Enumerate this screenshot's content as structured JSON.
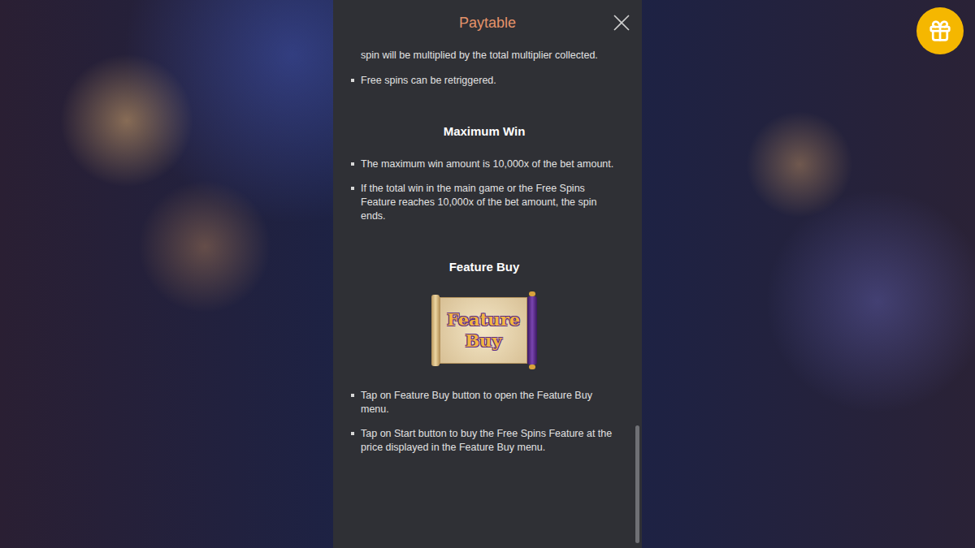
{
  "header": {
    "title": "Paytable"
  },
  "intro": [
    {
      "kind": "continuation",
      "text": "spin will be multiplied by the total multiplier collected."
    },
    {
      "kind": "bullet",
      "text": "Free spins can be retriggered."
    }
  ],
  "sections": [
    {
      "title": "Maximum Win",
      "badge": null,
      "items": [
        "The maximum win amount is 10,000x of the bet amount.",
        "If the total win in the main game or the Free Spins Feature reaches 10,000x of the bet amount, the spin ends."
      ]
    },
    {
      "title": "Feature Buy",
      "badge": "Feature Buy",
      "items": [
        "Tap on Feature Buy button to open the Feature Buy menu.",
        "Tap on Start button to buy the Free Spins Feature at the price displayed in the Feature Buy menu."
      ]
    }
  ],
  "scrollbar": {
    "level": 1
  }
}
